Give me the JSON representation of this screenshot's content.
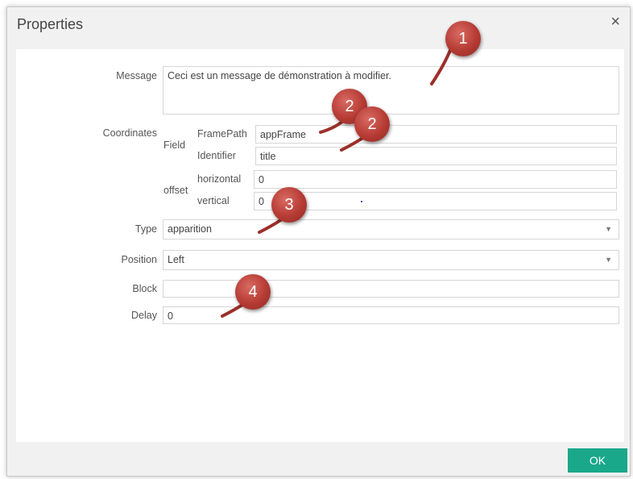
{
  "dialog": {
    "title": "Properties",
    "close_symbol": "×",
    "ok_label": "OK"
  },
  "form": {
    "message_label": "Message",
    "message_value": "Ceci est un message de démonstration à modifier.",
    "coordinates_label": "Coordinates",
    "field_label": "Field",
    "framepath_label": "FramePath",
    "framepath_value": "appFrame",
    "identifier_label": "Identifier",
    "identifier_value": "title",
    "offset_label": "offset",
    "horizontal_label": "horizontal",
    "horizontal_value": "0",
    "vertical_label": "vertical",
    "vertical_value": "0",
    "type_label": "Type",
    "type_value": "apparition",
    "position_label": "Position",
    "position_value": "Left",
    "block_label": "Block",
    "block_value": "",
    "delay_label": "Delay",
    "delay_value": "0"
  },
  "annotations": {
    "badge_1": "1",
    "badge_2a": "2",
    "badge_2b": "2",
    "badge_3": "3",
    "badge_4": "4"
  },
  "colors": {
    "ok_button": "#1aa88a",
    "badge": "#b53b34",
    "dialog_bg": "#f1f1f1"
  },
  "icons": [
    "close-icon",
    "chevron-down-icon"
  ]
}
